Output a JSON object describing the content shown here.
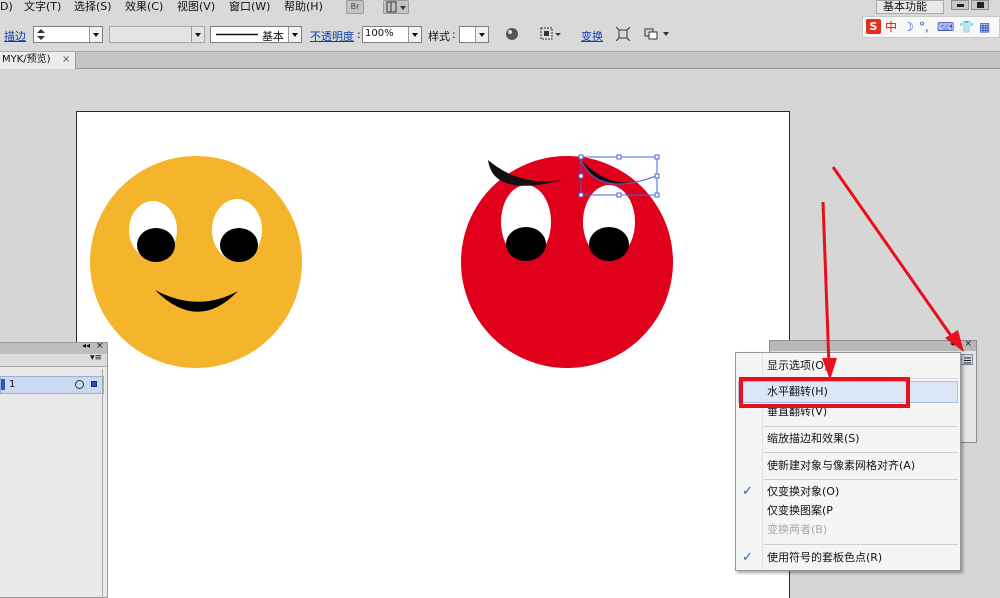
{
  "menu": {
    "items": [
      "D)",
      "文字(T)",
      "选择(S)",
      "效果(C)",
      "视图(V)",
      "窗口(W)",
      "帮助(H)"
    ],
    "bridge_label": "Br",
    "workspace": "基本功能"
  },
  "control_bar": {
    "stroke_label": "描边",
    "stroke_style": "基本",
    "opacity_label": "不透明度",
    "opacity_value": "100%",
    "style_label": "样式",
    "transform_label": "变换"
  },
  "ime": {
    "brand": "S",
    "lang": "中"
  },
  "document": {
    "tab_label": "MYK/预览)",
    "close_label": "×"
  },
  "layers": {
    "layer_name": "1"
  },
  "transform_panel": {
    "close_label": "×"
  },
  "context_menu": {
    "items": [
      {
        "label": "显示选项(O)",
        "checked": false,
        "disabled": false
      },
      {
        "label": "水平翻转(H)",
        "checked": false,
        "disabled": false
      },
      {
        "label": "垂直翻转(V)",
        "checked": false,
        "disabled": false
      },
      {
        "label": "缩放描边和效果(S)",
        "checked": false,
        "disabled": false
      },
      {
        "label": "使新建对象与像素网格对齐(A)",
        "checked": false,
        "disabled": false
      },
      {
        "label": "仅变换对象(O)",
        "checked": true,
        "disabled": false
      },
      {
        "label": "仅变换图案(P",
        "checked": false,
        "disabled": false
      },
      {
        "label": "变换两者(B)",
        "checked": false,
        "disabled": true
      },
      {
        "label": "使用符号的套板色点(R)",
        "checked": true,
        "disabled": false
      }
    ]
  },
  "colors": {
    "yellow_face": "#f4b42c",
    "red_face": "#e0001b",
    "highlight_red": "#e8101c",
    "selection_blue": "#4a63d8"
  },
  "icons": [
    "check-icon",
    "close-icon",
    "arrow-icon"
  ]
}
